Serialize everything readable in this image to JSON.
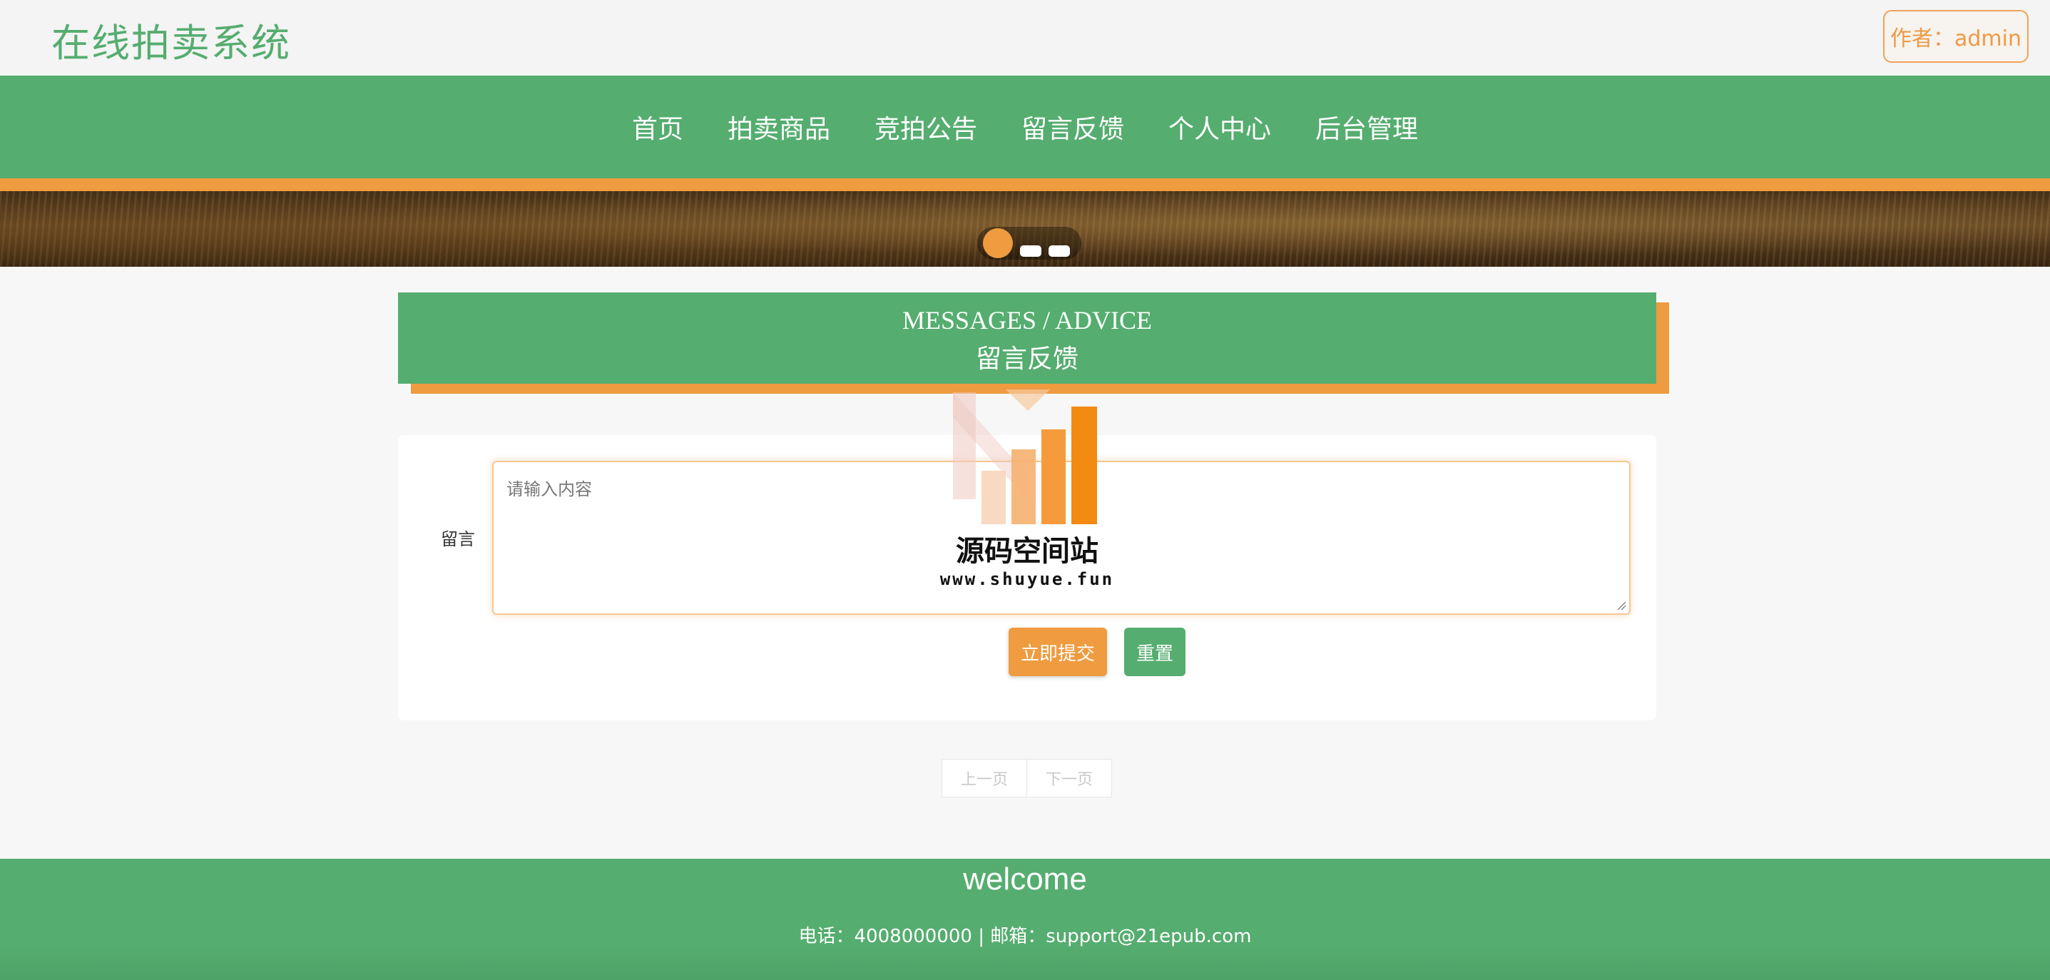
{
  "header": {
    "site_title": "在线拍卖系统",
    "author_label": "作者：admin"
  },
  "nav": {
    "items": [
      {
        "label": "首页"
      },
      {
        "label": "拍卖商品"
      },
      {
        "label": "竞拍公告"
      },
      {
        "label": "留言反馈"
      },
      {
        "label": "个人中心"
      },
      {
        "label": "后台管理"
      }
    ]
  },
  "banner": {
    "slide_count": 3,
    "active_slide": 1
  },
  "section": {
    "title_en": "MESSAGES / ADVICE",
    "title_cn": "留言反馈"
  },
  "form": {
    "message_label": "留言",
    "message_placeholder": "请输入内容",
    "message_value": "",
    "submit_label": "立即提交",
    "reset_label": "重置"
  },
  "pager": {
    "prev_label": "上一页",
    "next_label": "下一页"
  },
  "watermark": {
    "title": "源码空间站",
    "url": "www.shuyue.fun"
  },
  "footer": {
    "welcome": "welcome",
    "contact": "电话：4008000000 | 邮箱：support@21epub.com"
  },
  "colors": {
    "primary_green": "#55ad6f",
    "accent_orange": "#ef9b3f"
  }
}
